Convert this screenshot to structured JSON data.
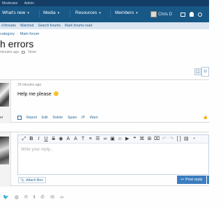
{
  "topbar": {
    "items": [
      "Moderator",
      "Admin"
    ]
  },
  "nav": {
    "whats_new": "What's new",
    "media": "Media",
    "resources": "Resources",
    "members": "Members",
    "user_name": "Chris D"
  },
  "subnav": {
    "items": [
      "d threads",
      "Watched",
      "Search forums",
      "Mark forums read"
    ]
  },
  "breadcrumb": {
    "items": [
      "category",
      "Main forum"
    ]
  },
  "thread": {
    "title": "h errors",
    "started": "minutes ago",
    "tags": "None"
  },
  "post": {
    "date": "29 minutes ago",
    "message": "Help me please",
    "username": "er"
  },
  "post_actions": {
    "report": "Report",
    "edit": "Edit",
    "delete": "Delete",
    "spam": "Spam",
    "ip": "IP",
    "warn": "Warn"
  },
  "editor": {
    "placeholder": "Write your reply..."
  },
  "reply": {
    "attach_label": "Attach files",
    "post_reply_label": "Post reply"
  },
  "icons": {
    "share": [
      "twitter-icon",
      "reddit-icon",
      "pinterest-icon",
      "tumblr-icon",
      "whatsapp-icon",
      "email-icon",
      "link-icon"
    ]
  },
  "colors": {
    "navbar": "#185886",
    "topbar": "#143e66",
    "subnav": "#dbe6f1",
    "accent": "#2c6a99",
    "button": "#3b7dc0"
  }
}
